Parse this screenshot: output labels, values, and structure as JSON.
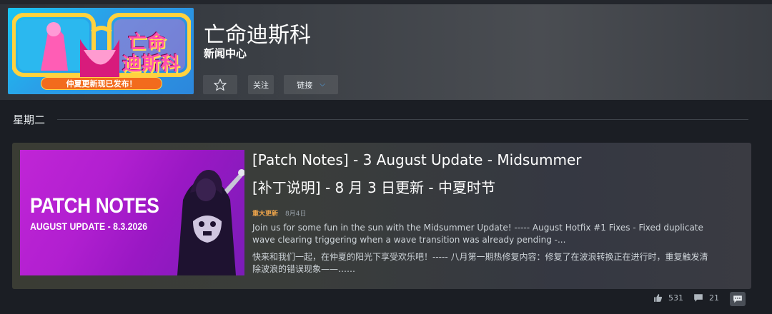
{
  "header": {
    "app_title": "亡命迪斯科",
    "subtitle": "新闻中心",
    "follow_label": "关注",
    "link_label": "链接",
    "capsule": {
      "logo_line1": "亡命",
      "logo_line2": "迪斯科",
      "banner": "仲夏更新现已发布！"
    }
  },
  "day_heading": "星期二",
  "post": {
    "title_en": "[Patch Notes] - 3 August Update - Midsummer",
    "title_zh": "[补丁说明] - 8 月 3 日更新 - 中夏时节",
    "tag": "重大更新",
    "date": "8月4日",
    "summary_en": "Join us for some fun in the sun with the Midsummer Update! ----- August Hotfix #1 Fixes - Fixed duplicate wave clearing triggering when a wave transition was already pending -...",
    "summary_zh": "快来和我们一起，在仲夏的阳光下享受欢乐吧！----- 八月第一期热修复内容：修复了在波浪转换正在进行时，重复触发清除波浪的错误现象——……",
    "thumbnail": {
      "headline": "PATCH NOTES",
      "subline": "AUGUST UPDATE  -  8.3.2026"
    }
  },
  "stats": {
    "likes": "531",
    "comments": "21"
  },
  "colors": {
    "tag": "#e8a14a",
    "accent": "#4fa9f5"
  }
}
